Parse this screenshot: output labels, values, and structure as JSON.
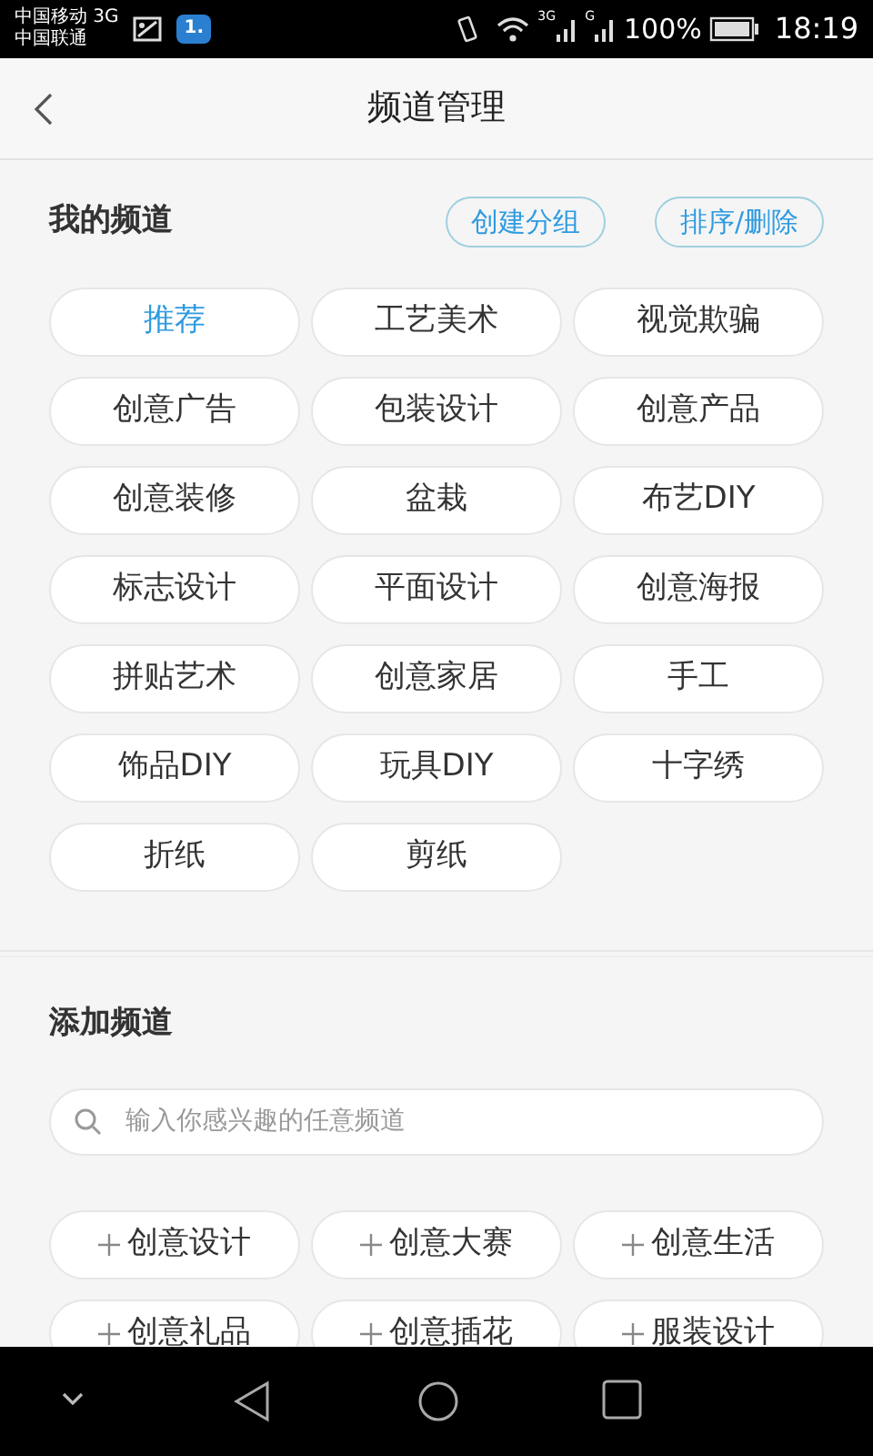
{
  "status_bar": {
    "carrier_1": "中国移动 3G",
    "carrier_2": "中国联通",
    "notification_badge": "1.",
    "signal_1_label": "3G",
    "signal_2_label": "G",
    "battery": "100%",
    "time": "18:19"
  },
  "header": {
    "title": "频道管理"
  },
  "my_channels": {
    "title": "我的频道",
    "buttons": [
      "创建分组",
      "排序/删除"
    ],
    "items": [
      {
        "label": "推荐",
        "selected": true
      },
      {
        "label": "工艺美术",
        "selected": false
      },
      {
        "label": "视觉欺骗",
        "selected": false
      },
      {
        "label": "创意广告",
        "selected": false
      },
      {
        "label": "包装设计",
        "selected": false
      },
      {
        "label": "创意产品",
        "selected": false
      },
      {
        "label": "创意装修",
        "selected": false
      },
      {
        "label": "盆栽",
        "selected": false
      },
      {
        "label": "布艺DIY",
        "selected": false
      },
      {
        "label": "标志设计",
        "selected": false
      },
      {
        "label": "平面设计",
        "selected": false
      },
      {
        "label": "创意海报",
        "selected": false
      },
      {
        "label": "拼贴艺术",
        "selected": false
      },
      {
        "label": "创意家居",
        "selected": false
      },
      {
        "label": "手工",
        "selected": false
      },
      {
        "label": "饰品DIY",
        "selected": false
      },
      {
        "label": "玩具DIY",
        "selected": false
      },
      {
        "label": "十字绣",
        "selected": false
      },
      {
        "label": "折纸",
        "selected": false
      },
      {
        "label": "剪纸",
        "selected": false
      }
    ]
  },
  "add_channels": {
    "title": "添加频道",
    "search": {
      "placeholder": "输入你感兴趣的任意频道"
    },
    "items": [
      "创意设计",
      "创意大赛",
      "创意生活",
      "创意礼品",
      "创意插花",
      "服装设计"
    ]
  }
}
